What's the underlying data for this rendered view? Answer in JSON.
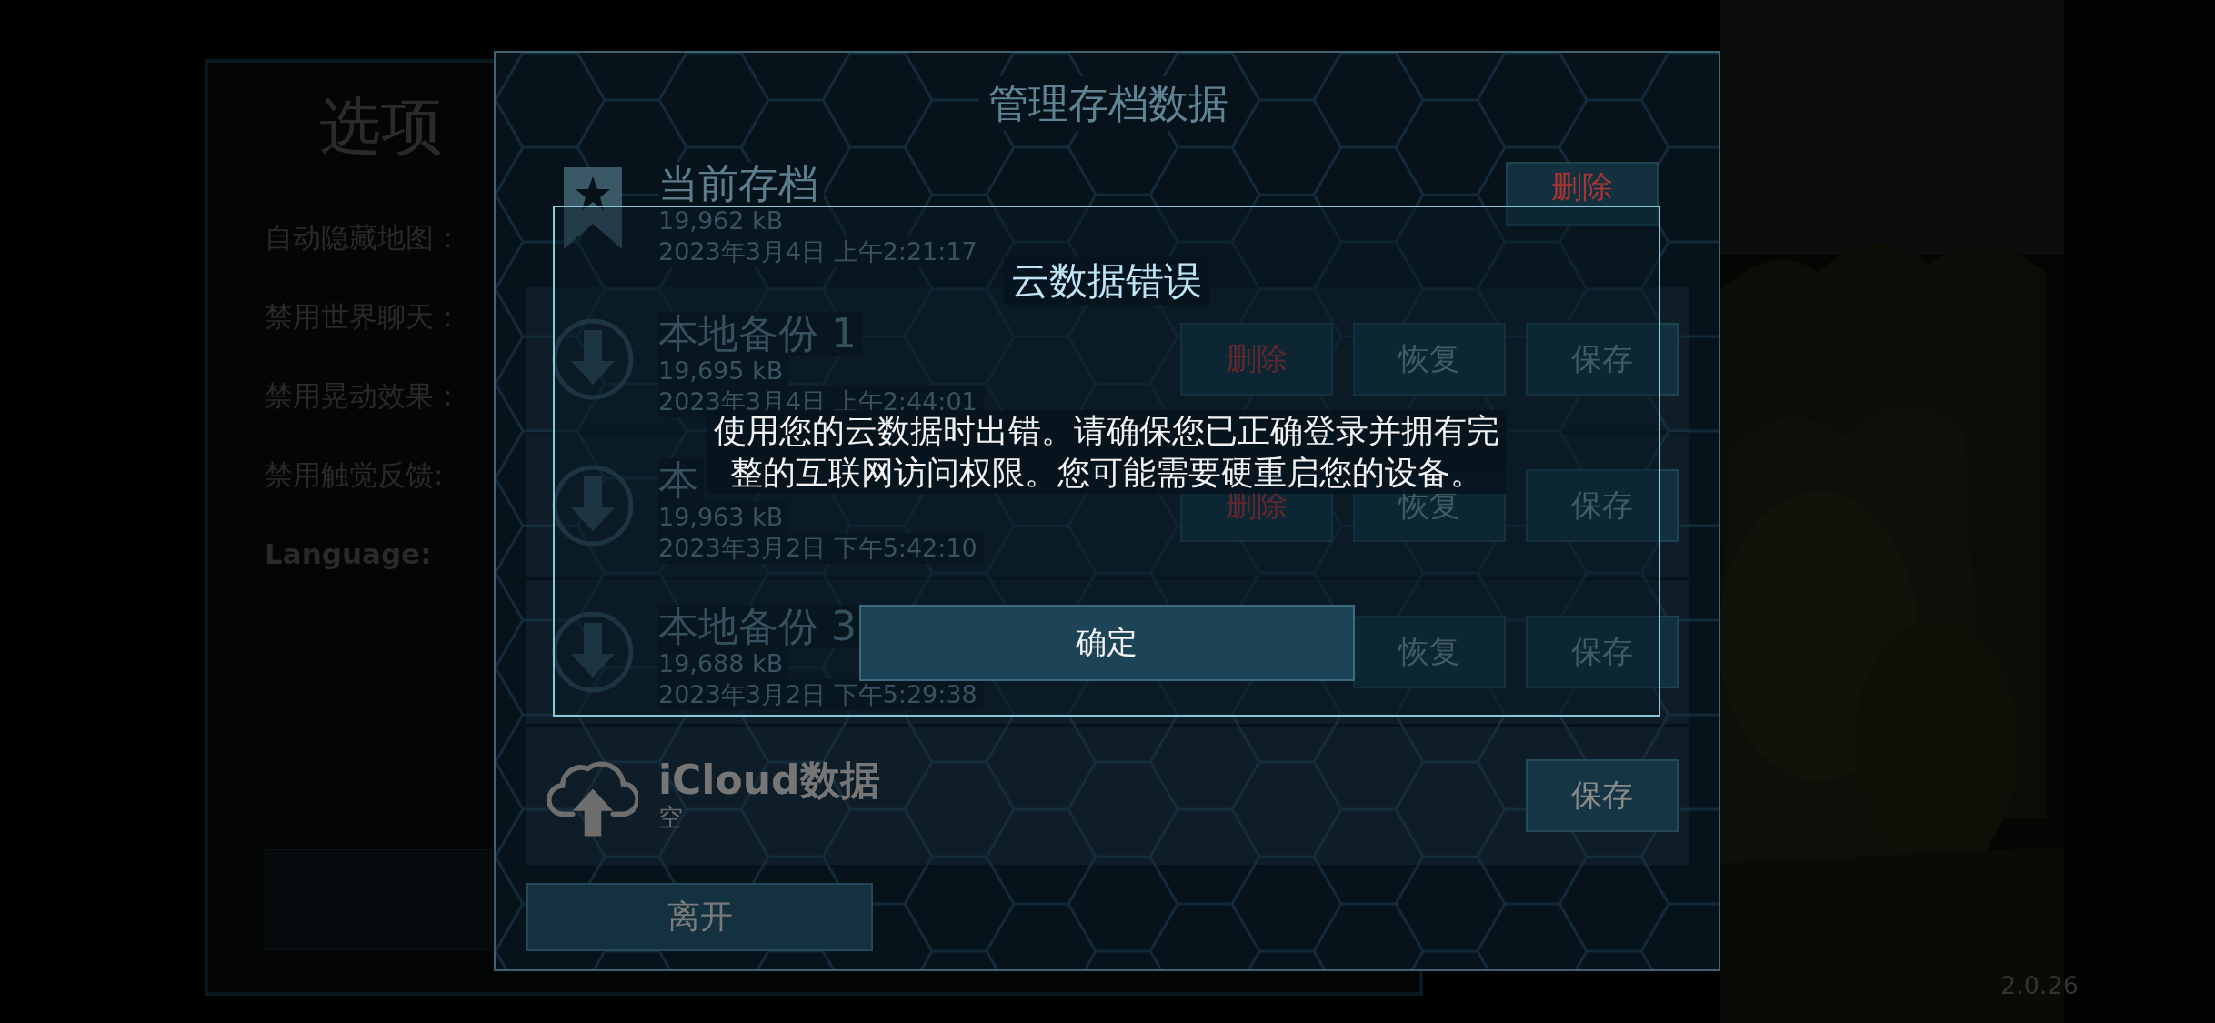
{
  "options_panel": {
    "title": "选项",
    "settings": [
      {
        "label": "自动隐藏地图："
      },
      {
        "label": "禁用世界聊天："
      },
      {
        "label": "禁用晃动效果："
      },
      {
        "label": "禁用触觉反馈:"
      },
      {
        "label": "Language:"
      }
    ]
  },
  "save_panel": {
    "title": "管理存档数据",
    "current_save": {
      "title": "当前存档",
      "size": "19,962 kB",
      "date": "2023年3月4日 上午2:21:17",
      "buttons": [
        {
          "label": "删除",
          "kind": "danger"
        }
      ]
    },
    "backups": [
      {
        "title": "本地备份 1",
        "size": "19,695 kB",
        "date": "2023年3月4日 上午2:44:01",
        "buttons": [
          {
            "label": "删除",
            "kind": "danger"
          },
          {
            "label": "恢复",
            "kind": "normal"
          },
          {
            "label": "保存",
            "kind": "normal"
          }
        ]
      },
      {
        "title": "本",
        "size": "19,963 kB",
        "date": "2023年3月2日 下午5:42:10",
        "buttons": [
          {
            "label": "删除",
            "kind": "danger"
          },
          {
            "label": "恢复",
            "kind": "normal"
          },
          {
            "label": "保存",
            "kind": "normal"
          }
        ]
      },
      {
        "title": "本地备份 3",
        "size": "19,688 kB",
        "date": "2023年3月2日 下午5:29:38",
        "buttons": [
          {
            "label": "恢复",
            "kind": "normal"
          },
          {
            "label": "保存",
            "kind": "normal"
          }
        ]
      }
    ],
    "icloud": {
      "title": "iCloud数据",
      "status": "空",
      "buttons": [
        {
          "label": "保存",
          "kind": "normal"
        }
      ]
    },
    "leave_button": "离开"
  },
  "dialog": {
    "title": "云数据错误",
    "message": "使用您的云数据时出错。请确保您已正确登录并拥有完整的互联网访问权限。您可能需要硬重启您的设备。",
    "confirm": "确定"
  },
  "version": "2.0.26"
}
